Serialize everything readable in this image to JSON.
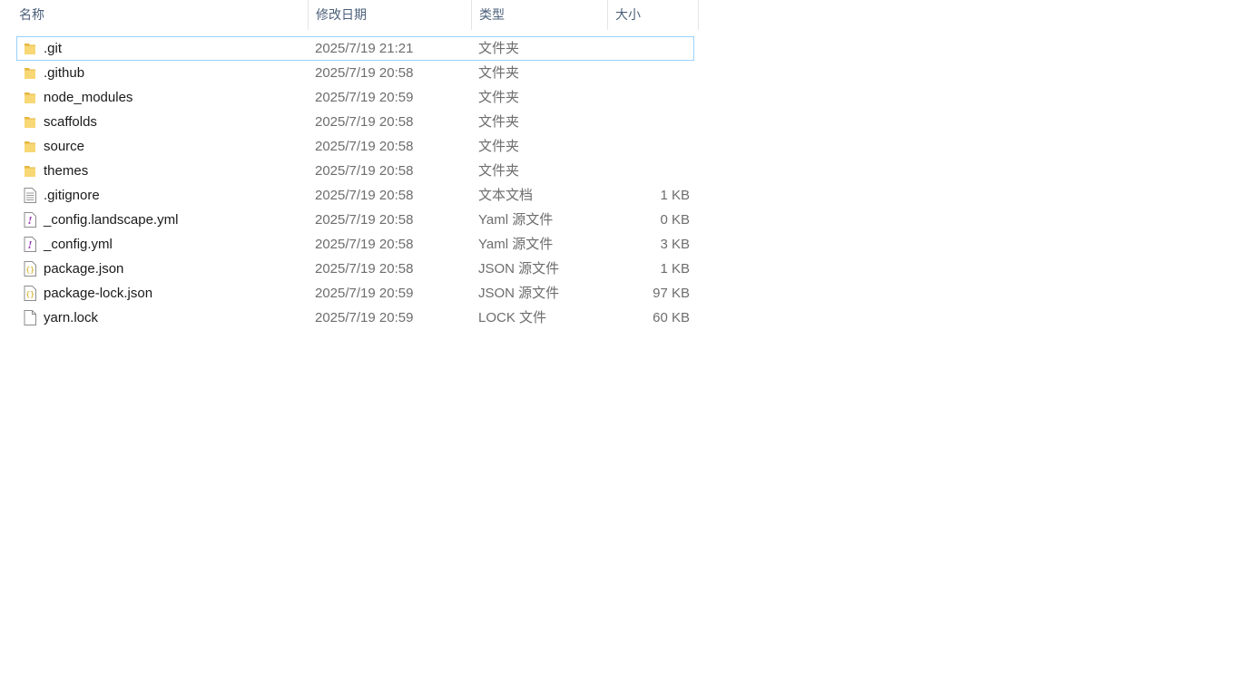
{
  "columns": {
    "name": "名称",
    "date": "修改日期",
    "type": "类型",
    "size": "大小"
  },
  "sort_indicator": "^",
  "colors": {
    "folder": "#f8d775",
    "folder_dark": "#e6b740",
    "focus_border": "#99d1ff",
    "header_text": "#4c607a",
    "meta_text": "#6d6d6d"
  },
  "files": [
    {
      "name": ".git",
      "date": "2025/7/19 21:21",
      "type": "文件夹",
      "size": "",
      "icon": "folder-icon"
    },
    {
      "name": ".github",
      "date": "2025/7/19 20:58",
      "type": "文件夹",
      "size": "",
      "icon": "folder-icon"
    },
    {
      "name": "node_modules",
      "date": "2025/7/19 20:59",
      "type": "文件夹",
      "size": "",
      "icon": "folder-icon"
    },
    {
      "name": "scaffolds",
      "date": "2025/7/19 20:58",
      "type": "文件夹",
      "size": "",
      "icon": "folder-icon"
    },
    {
      "name": "source",
      "date": "2025/7/19 20:58",
      "type": "文件夹",
      "size": "",
      "icon": "folder-icon"
    },
    {
      "name": "themes",
      "date": "2025/7/19 20:58",
      "type": "文件夹",
      "size": "",
      "icon": "folder-icon"
    },
    {
      "name": ".gitignore",
      "date": "2025/7/19 20:58",
      "type": "文本文档",
      "size": "1 KB",
      "icon": "text-file-icon"
    },
    {
      "name": "_config.landscape.yml",
      "date": "2025/7/19 20:58",
      "type": "Yaml 源文件",
      "size": "0 KB",
      "icon": "yaml-file-icon"
    },
    {
      "name": "_config.yml",
      "date": "2025/7/19 20:58",
      "type": "Yaml 源文件",
      "size": "3 KB",
      "icon": "yaml-file-icon"
    },
    {
      "name": "package.json",
      "date": "2025/7/19 20:58",
      "type": "JSON 源文件",
      "size": "1 KB",
      "icon": "json-file-icon"
    },
    {
      "name": "package-lock.json",
      "date": "2025/7/19 20:59",
      "type": "JSON 源文件",
      "size": "97 KB",
      "icon": "json-file-icon"
    },
    {
      "name": "yarn.lock",
      "date": "2025/7/19 20:59",
      "type": "LOCK 文件",
      "size": "60 KB",
      "icon": "blank-file-icon"
    }
  ]
}
